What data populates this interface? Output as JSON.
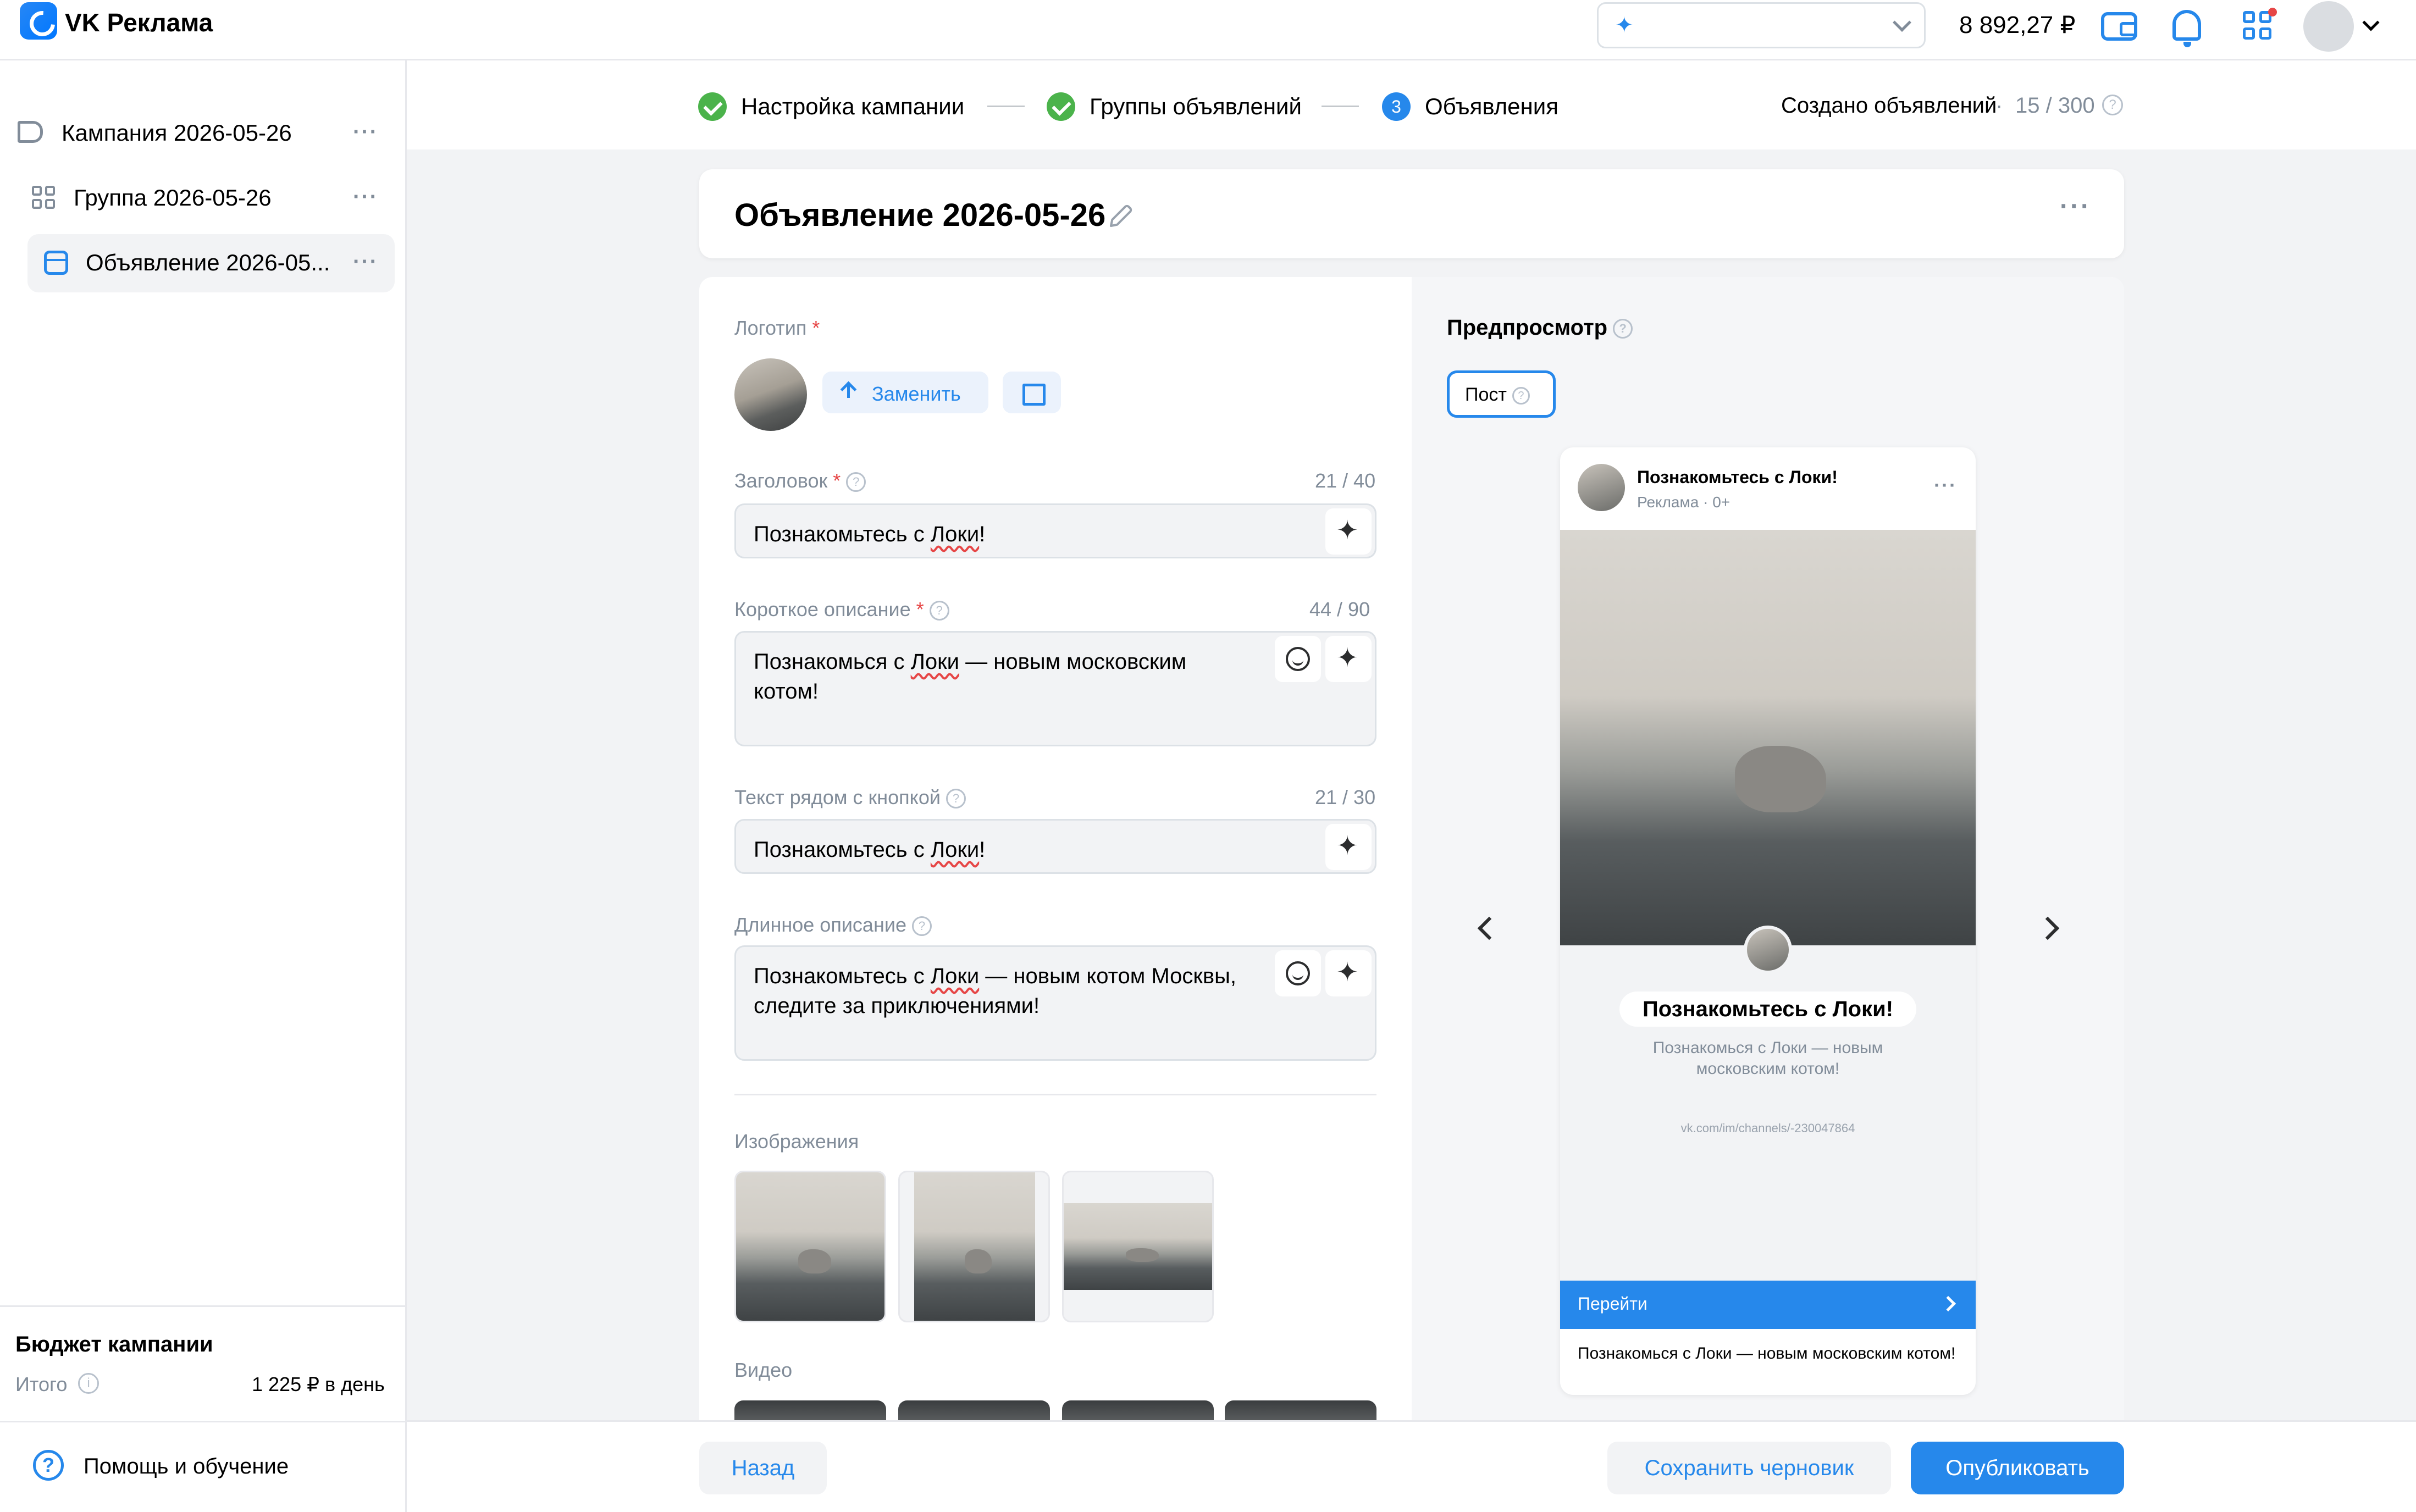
{
  "header": {
    "app_title": "VK Реклама",
    "ai_selector_value": "",
    "balance": "8 892,27 ₽"
  },
  "sidebar": {
    "items": [
      {
        "label": "Кампания 2026-05-26",
        "icon": "megaphone-icon",
        "active": false
      },
      {
        "label": "Группа 2026-05-26",
        "icon": "grid-icon",
        "active": false
      },
      {
        "label": "Объявление 2026-05...",
        "icon": "card-icon",
        "active": true
      }
    ],
    "more_label": "···",
    "budget": {
      "title": "Бюджет кампании",
      "label": "Итого",
      "value": "1 225 ₽ в день"
    },
    "help_label": "Помощь и обучение"
  },
  "steps": {
    "items": [
      {
        "label": "Настройка кампании",
        "state": "done"
      },
      {
        "label": "Группы объявлений",
        "state": "done"
      },
      {
        "label": "Объявления",
        "state": "current",
        "number": "3"
      }
    ],
    "created_label": "Создано объявлений",
    "created_sep": "·",
    "created_count": "15 / 300"
  },
  "ad": {
    "title": "Объявление 2026-05-26",
    "more_label": "···"
  },
  "form": {
    "logo_label": "Логотип",
    "required_mark": "*",
    "replace_label": "Заменить",
    "headline": {
      "label": "Заголовок",
      "count": "21 / 40",
      "value": "Познакомьтесь с Локи!"
    },
    "short_desc": {
      "label": "Короткое описание",
      "count": "44 / 90",
      "value_pre": "Познакомься с ",
      "value_mark": "Локи",
      "value_post": " — новым московским котом!"
    },
    "button_text": {
      "label": "Текст рядом с кнопкой",
      "count": "21 / 30",
      "value_pre": "Познакомьтесь с ",
      "value_mark": "Локи",
      "value_post": "!"
    },
    "long_desc": {
      "label": "Длинное описание",
      "value_pre": "Познакомьтесь с ",
      "value_mark": "Локи",
      "value_post": " — новым котом Москвы, следите за приключениями!"
    },
    "headline_pre": "Познакомьтесь с ",
    "headline_mark": "Локи",
    "headline_post": "!",
    "images_label": "Изображения",
    "video_label": "Видео"
  },
  "preview": {
    "title": "Предпросмотр",
    "tab_label": "Пост",
    "post": {
      "name": "Познакомьтесь с Локи!",
      "meta": "Реклама · 0+",
      "headline": "Познакомьтесь с Локи!",
      "desc": "Познакомься с Локи — новым московским котом!",
      "link": "vk.com/im/channels/-230047864",
      "cta": "Перейти",
      "footer": "Познакомься с Локи — новым московским котом!"
    }
  },
  "footer": {
    "back_label": "Назад",
    "draft_label": "Сохранить черновик",
    "publish_label": "Опубликовать"
  },
  "colors": {
    "accent": "#2688eb",
    "success": "#4bb34b",
    "error": "#e64646",
    "muted": "#818c99"
  }
}
